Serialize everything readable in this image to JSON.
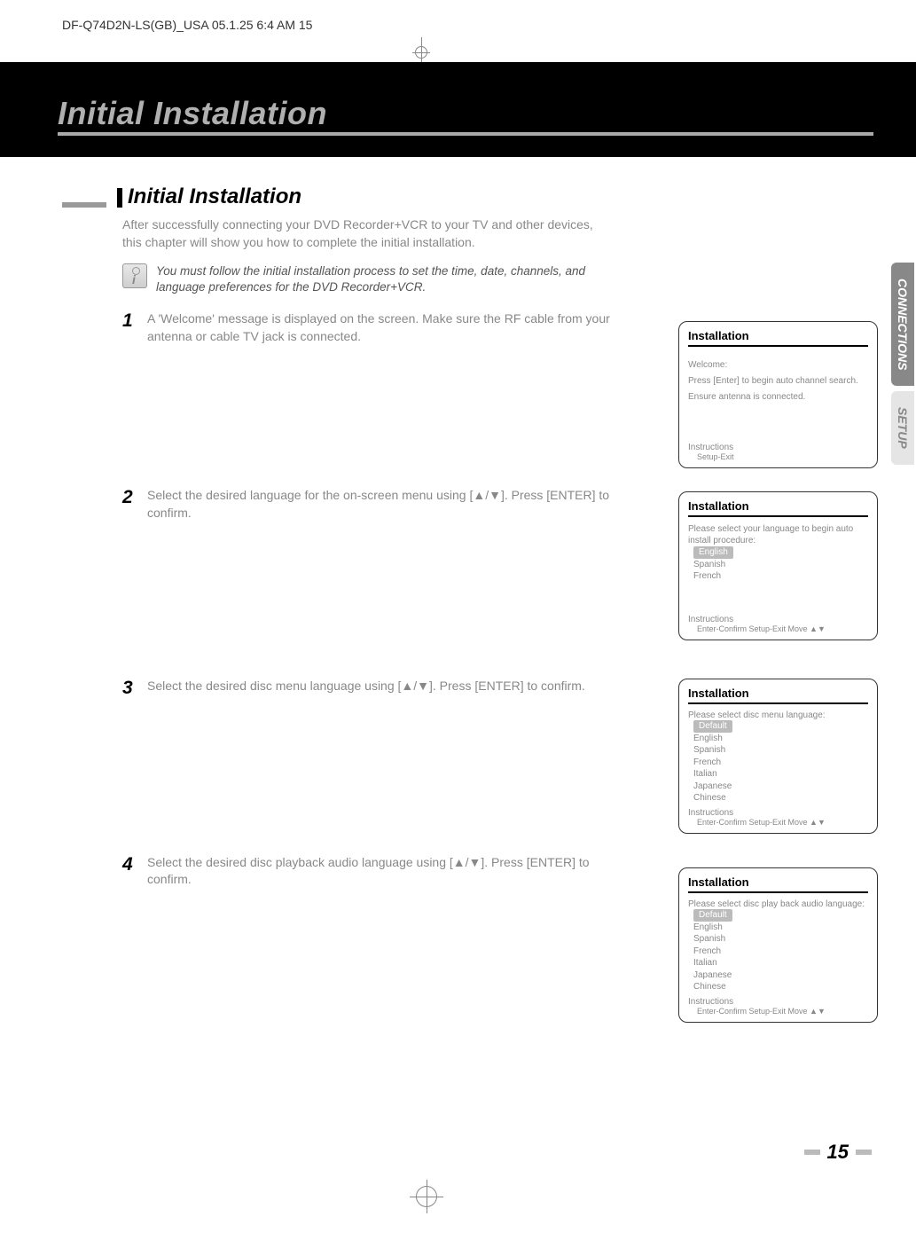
{
  "header_line": "DF-Q74D2N-LS(GB)_USA  05.1.25 6:4 AM      15",
  "chapter_title": "Initial Installation",
  "section_title": "Initial Installation",
  "intro": "After successfully connecting your DVD Recorder+VCR to your TV and other devices, this chapter will show you how to complete the initial installation.",
  "note": "You must follow the initial installation process to set the time, date, channels, and language preferences for the DVD Recorder+VCR.",
  "steps": {
    "s1num": "1",
    "s1": "A 'Welcome' message is displayed on the screen. Make sure the RF cable from your antenna or cable TV jack is connected.",
    "s2num": "2",
    "s2": "Select the desired language for the on-screen menu using [▲/▼]. Press [ENTER] to confirm.",
    "s3num": "3",
    "s3": "Select the desired disc menu language using [▲/▼]. Press [ENTER] to confirm.",
    "s4num": "4",
    "s4": "Select the desired disc playback audio language using [▲/▼]. Press [ENTER] to confirm."
  },
  "screens": {
    "title": "Installation",
    "s1": {
      "line1": "Welcome:",
      "line2": "Press [Enter] to begin auto channel search.",
      "line3": "Ensure antenna is connected.",
      "instr_label": "Instructions",
      "instr": "Setup-Exit"
    },
    "s2": {
      "prompt": "Please select your language to begin auto install procedure:",
      "opt1": "English",
      "opt2": "Spanish",
      "opt3": "French",
      "instr_label": "Instructions",
      "instr": "Enter-Confirm   Setup-Exit   Move ▲▼"
    },
    "s3": {
      "prompt": "Please select disc menu language:",
      "opt1": "Default",
      "opt2": "English",
      "opt3": "Spanish",
      "opt4": "French",
      "opt5": "Italian",
      "opt6": "Japanese",
      "opt7": "Chinese",
      "instr_label": "Instructions",
      "instr": "Enter-Confirm   Setup-Exit   Move ▲▼"
    },
    "s4": {
      "prompt": "Please select disc play back audio language:",
      "opt1": "Default",
      "opt2": "English",
      "opt3": "Spanish",
      "opt4": "French",
      "opt5": "Italian",
      "opt6": "Japanese",
      "opt7": "Chinese",
      "instr_label": "Instructions",
      "instr": "Enter-Confirm   Setup-Exit   Move ▲▼"
    }
  },
  "tabs": {
    "t1": "CONNECTIONS",
    "t2": "SETUP"
  },
  "page_number": "15"
}
